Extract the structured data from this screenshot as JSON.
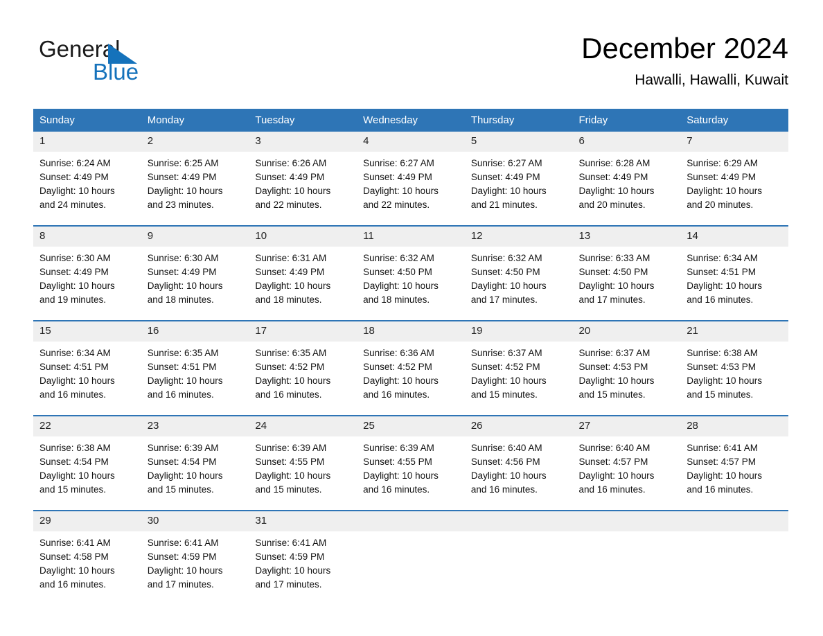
{
  "brand": {
    "line1": "General",
    "line2": "Blue",
    "mark": "triangle-logo"
  },
  "header": {
    "month_title": "December 2024",
    "location": "Hawalli, Hawalli, Kuwait"
  },
  "colors": {
    "header_blue": "#2e75b6",
    "brand_blue": "#1572bb",
    "daynum_band": "#efefef",
    "page_background": "#ffffff"
  },
  "calendar": {
    "weekday_headers": [
      "Sunday",
      "Monday",
      "Tuesday",
      "Wednesday",
      "Thursday",
      "Friday",
      "Saturday"
    ],
    "labels": {
      "sunrise_prefix": "Sunrise:",
      "sunset_prefix": "Sunset:",
      "daylight_prefix": "Daylight:"
    },
    "weeks": [
      [
        {
          "day": "1",
          "sunrise": "Sunrise: 6:24 AM",
          "sunset": "Sunset: 4:49 PM",
          "daylight_l1": "Daylight: 10 hours",
          "daylight_l2": "and 24 minutes."
        },
        {
          "day": "2",
          "sunrise": "Sunrise: 6:25 AM",
          "sunset": "Sunset: 4:49 PM",
          "daylight_l1": "Daylight: 10 hours",
          "daylight_l2": "and 23 minutes."
        },
        {
          "day": "3",
          "sunrise": "Sunrise: 6:26 AM",
          "sunset": "Sunset: 4:49 PM",
          "daylight_l1": "Daylight: 10 hours",
          "daylight_l2": "and 22 minutes."
        },
        {
          "day": "4",
          "sunrise": "Sunrise: 6:27 AM",
          "sunset": "Sunset: 4:49 PM",
          "daylight_l1": "Daylight: 10 hours",
          "daylight_l2": "and 22 minutes."
        },
        {
          "day": "5",
          "sunrise": "Sunrise: 6:27 AM",
          "sunset": "Sunset: 4:49 PM",
          "daylight_l1": "Daylight: 10 hours",
          "daylight_l2": "and 21 minutes."
        },
        {
          "day": "6",
          "sunrise": "Sunrise: 6:28 AM",
          "sunset": "Sunset: 4:49 PM",
          "daylight_l1": "Daylight: 10 hours",
          "daylight_l2": "and 20 minutes."
        },
        {
          "day": "7",
          "sunrise": "Sunrise: 6:29 AM",
          "sunset": "Sunset: 4:49 PM",
          "daylight_l1": "Daylight: 10 hours",
          "daylight_l2": "and 20 minutes."
        }
      ],
      [
        {
          "day": "8",
          "sunrise": "Sunrise: 6:30 AM",
          "sunset": "Sunset: 4:49 PM",
          "daylight_l1": "Daylight: 10 hours",
          "daylight_l2": "and 19 minutes."
        },
        {
          "day": "9",
          "sunrise": "Sunrise: 6:30 AM",
          "sunset": "Sunset: 4:49 PM",
          "daylight_l1": "Daylight: 10 hours",
          "daylight_l2": "and 18 minutes."
        },
        {
          "day": "10",
          "sunrise": "Sunrise: 6:31 AM",
          "sunset": "Sunset: 4:49 PM",
          "daylight_l1": "Daylight: 10 hours",
          "daylight_l2": "and 18 minutes."
        },
        {
          "day": "11",
          "sunrise": "Sunrise: 6:32 AM",
          "sunset": "Sunset: 4:50 PM",
          "daylight_l1": "Daylight: 10 hours",
          "daylight_l2": "and 18 minutes."
        },
        {
          "day": "12",
          "sunrise": "Sunrise: 6:32 AM",
          "sunset": "Sunset: 4:50 PM",
          "daylight_l1": "Daylight: 10 hours",
          "daylight_l2": "and 17 minutes."
        },
        {
          "day": "13",
          "sunrise": "Sunrise: 6:33 AM",
          "sunset": "Sunset: 4:50 PM",
          "daylight_l1": "Daylight: 10 hours",
          "daylight_l2": "and 17 minutes."
        },
        {
          "day": "14",
          "sunrise": "Sunrise: 6:34 AM",
          "sunset": "Sunset: 4:51 PM",
          "daylight_l1": "Daylight: 10 hours",
          "daylight_l2": "and 16 minutes."
        }
      ],
      [
        {
          "day": "15",
          "sunrise": "Sunrise: 6:34 AM",
          "sunset": "Sunset: 4:51 PM",
          "daylight_l1": "Daylight: 10 hours",
          "daylight_l2": "and 16 minutes."
        },
        {
          "day": "16",
          "sunrise": "Sunrise: 6:35 AM",
          "sunset": "Sunset: 4:51 PM",
          "daylight_l1": "Daylight: 10 hours",
          "daylight_l2": "and 16 minutes."
        },
        {
          "day": "17",
          "sunrise": "Sunrise: 6:35 AM",
          "sunset": "Sunset: 4:52 PM",
          "daylight_l1": "Daylight: 10 hours",
          "daylight_l2": "and 16 minutes."
        },
        {
          "day": "18",
          "sunrise": "Sunrise: 6:36 AM",
          "sunset": "Sunset: 4:52 PM",
          "daylight_l1": "Daylight: 10 hours",
          "daylight_l2": "and 16 minutes."
        },
        {
          "day": "19",
          "sunrise": "Sunrise: 6:37 AM",
          "sunset": "Sunset: 4:52 PM",
          "daylight_l1": "Daylight: 10 hours",
          "daylight_l2": "and 15 minutes."
        },
        {
          "day": "20",
          "sunrise": "Sunrise: 6:37 AM",
          "sunset": "Sunset: 4:53 PM",
          "daylight_l1": "Daylight: 10 hours",
          "daylight_l2": "and 15 minutes."
        },
        {
          "day": "21",
          "sunrise": "Sunrise: 6:38 AM",
          "sunset": "Sunset: 4:53 PM",
          "daylight_l1": "Daylight: 10 hours",
          "daylight_l2": "and 15 minutes."
        }
      ],
      [
        {
          "day": "22",
          "sunrise": "Sunrise: 6:38 AM",
          "sunset": "Sunset: 4:54 PM",
          "daylight_l1": "Daylight: 10 hours",
          "daylight_l2": "and 15 minutes."
        },
        {
          "day": "23",
          "sunrise": "Sunrise: 6:39 AM",
          "sunset": "Sunset: 4:54 PM",
          "daylight_l1": "Daylight: 10 hours",
          "daylight_l2": "and 15 minutes."
        },
        {
          "day": "24",
          "sunrise": "Sunrise: 6:39 AM",
          "sunset": "Sunset: 4:55 PM",
          "daylight_l1": "Daylight: 10 hours",
          "daylight_l2": "and 15 minutes."
        },
        {
          "day": "25",
          "sunrise": "Sunrise: 6:39 AM",
          "sunset": "Sunset: 4:55 PM",
          "daylight_l1": "Daylight: 10 hours",
          "daylight_l2": "and 16 minutes."
        },
        {
          "day": "26",
          "sunrise": "Sunrise: 6:40 AM",
          "sunset": "Sunset: 4:56 PM",
          "daylight_l1": "Daylight: 10 hours",
          "daylight_l2": "and 16 minutes."
        },
        {
          "day": "27",
          "sunrise": "Sunrise: 6:40 AM",
          "sunset": "Sunset: 4:57 PM",
          "daylight_l1": "Daylight: 10 hours",
          "daylight_l2": "and 16 minutes."
        },
        {
          "day": "28",
          "sunrise": "Sunrise: 6:41 AM",
          "sunset": "Sunset: 4:57 PM",
          "daylight_l1": "Daylight: 10 hours",
          "daylight_l2": "and 16 minutes."
        }
      ],
      [
        {
          "day": "29",
          "sunrise": "Sunrise: 6:41 AM",
          "sunset": "Sunset: 4:58 PM",
          "daylight_l1": "Daylight: 10 hours",
          "daylight_l2": "and 16 minutes."
        },
        {
          "day": "30",
          "sunrise": "Sunrise: 6:41 AM",
          "sunset": "Sunset: 4:59 PM",
          "daylight_l1": "Daylight: 10 hours",
          "daylight_l2": "and 17 minutes."
        },
        {
          "day": "31",
          "sunrise": "Sunrise: 6:41 AM",
          "sunset": "Sunset: 4:59 PM",
          "daylight_l1": "Daylight: 10 hours",
          "daylight_l2": "and 17 minutes."
        },
        {
          "day": "",
          "sunrise": "",
          "sunset": "",
          "daylight_l1": "",
          "daylight_l2": ""
        },
        {
          "day": "",
          "sunrise": "",
          "sunset": "",
          "daylight_l1": "",
          "daylight_l2": ""
        },
        {
          "day": "",
          "sunrise": "",
          "sunset": "",
          "daylight_l1": "",
          "daylight_l2": ""
        },
        {
          "day": "",
          "sunrise": "",
          "sunset": "",
          "daylight_l1": "",
          "daylight_l2": ""
        }
      ]
    ]
  }
}
